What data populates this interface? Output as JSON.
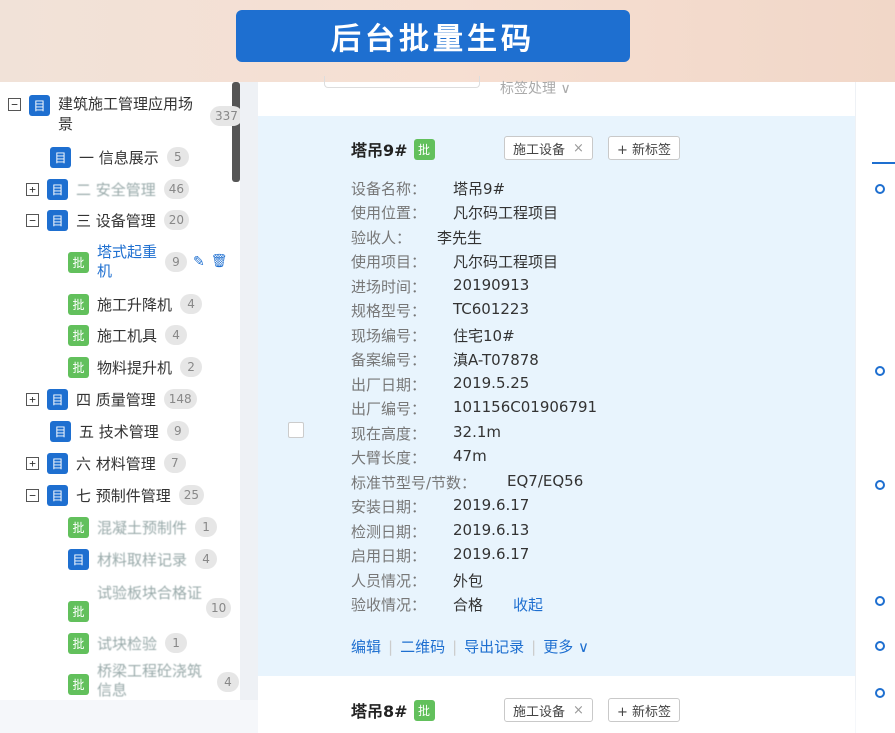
{
  "banner": {
    "title": "后台批量生码"
  },
  "sidebar": {
    "root": {
      "label": "建筑施工管理应用场景",
      "count": "337"
    },
    "items": [
      {
        "label": "一 信息展示",
        "count": "5",
        "icon": "目"
      },
      {
        "label": "二 安全管理",
        "count": "46",
        "icon": "目"
      },
      {
        "label": "三 设备管理",
        "count": "20",
        "icon": "目"
      },
      {
        "label": "塔式起重机",
        "count": "9",
        "icon": "批"
      },
      {
        "label": "施工升降机",
        "count": "4",
        "icon": "批"
      },
      {
        "label": "施工机具",
        "count": "4",
        "icon": "批"
      },
      {
        "label": "物料提升机",
        "count": "2",
        "icon": "批"
      },
      {
        "label": "四 质量管理",
        "count": "148",
        "icon": "目"
      },
      {
        "label": "五 技术管理",
        "count": "9",
        "icon": "目"
      },
      {
        "label": "六 材料管理",
        "count": "7",
        "icon": "目"
      },
      {
        "label": "七 预制件管理",
        "count": "25",
        "icon": "目"
      },
      {
        "label": "混凝土预制件",
        "count": "1",
        "icon": "批"
      },
      {
        "label": "材料取样记录",
        "count": "4",
        "icon": "目"
      },
      {
        "label": "试验板块合格证",
        "count": "10",
        "icon": "批"
      },
      {
        "label": "试块检验",
        "count": "1",
        "icon": "批"
      },
      {
        "label": "桥梁工程砼浇筑信息",
        "count": "4",
        "icon": "批"
      }
    ]
  },
  "main": {
    "filter_label": "标签处理 ∨",
    "card": {
      "name": "塔吊9#",
      "badge": "批",
      "tag": "施工设备",
      "tag_close": "×",
      "new_tag": "+ 新标签",
      "fields": [
        {
          "label": "设备名称：",
          "value": "塔吊9#"
        },
        {
          "label": "使用位置：",
          "value": "凡尔码工程项目"
        },
        {
          "label": "验收人：",
          "value": "李先生"
        },
        {
          "label": "使用项目：",
          "value": "凡尔码工程项目"
        },
        {
          "label": "进场时间：",
          "value": "20190913"
        },
        {
          "label": "规格型号：",
          "value": "TC601223"
        },
        {
          "label": "现场编号：",
          "value": "住宅10#"
        },
        {
          "label": "备案编号：",
          "value": "滇A-T07878"
        },
        {
          "label": "出厂日期：",
          "value": "2019.5.25"
        },
        {
          "label": "出厂编号：",
          "value": "101156C01906791"
        },
        {
          "label": "现在高度：",
          "value": "32.1m"
        },
        {
          "label": "大臂长度：",
          "value": "47m"
        },
        {
          "label": "标准节型号/节数：",
          "value": "EQ7/EQ56"
        },
        {
          "label": "安装日期：",
          "value": "2019.6.17"
        },
        {
          "label": "检测日期：",
          "value": "2019.6.13"
        },
        {
          "label": "启用日期：",
          "value": "2019.6.17"
        },
        {
          "label": "人员情况：",
          "value": "外包"
        },
        {
          "label": "验收情况：",
          "value": "合格"
        }
      ],
      "collapse_link": "收起",
      "actions": {
        "edit": "编辑",
        "qrcode": "二维码",
        "export": "导出记录",
        "more": "更多 ∨"
      }
    },
    "card2": {
      "name": "塔吊8#",
      "badge": "批",
      "tag": "施工设备",
      "tag_close": "×",
      "new_tag": "+ 新标签"
    }
  },
  "icons": {
    "expander_open": "−",
    "expander_closed": "+",
    "edit": "✎",
    "delete": "🗑"
  },
  "colors": {
    "accent": "#1e6fd0",
    "green_badge": "#62c05c",
    "card_bg": "#e8f4fd"
  }
}
